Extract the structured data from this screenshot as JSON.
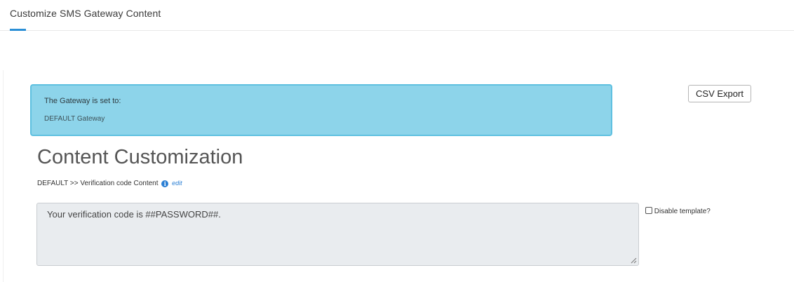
{
  "tabs": [
    {
      "label": "Customize SMS Gateway Content",
      "active": true
    }
  ],
  "gateway": {
    "label": "The Gateway is set to:",
    "value": "DEFAULT Gateway"
  },
  "toolbar": {
    "csv_export_label": "CSV Export"
  },
  "main": {
    "title": "Content Customization",
    "breadcrumb": {
      "path": "DEFAULT >> Verification code Content",
      "info_icon": "info-icon",
      "edit_label": "edit"
    },
    "template": {
      "value": "Your verification code is ##PASSWORD##."
    },
    "disable_template": {
      "label": "Disable template?",
      "checked": false
    }
  },
  "colors": {
    "accent": "#2b8fd6",
    "gateway_bg": "#8dd4ea",
    "gateway_border": "#5ec0e0",
    "textarea_bg": "#e9ecef"
  }
}
